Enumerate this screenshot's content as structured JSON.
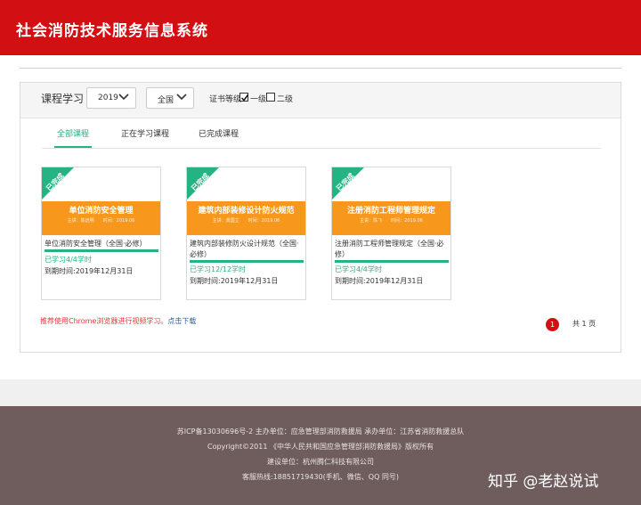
{
  "header": {
    "title": "社会消防技术服务信息系统"
  },
  "panel": {
    "title": "课程学习",
    "year_select": "2019",
    "scope_select": "全国",
    "cert_label": "证书等级",
    "cert_options": [
      {
        "label": "一级",
        "checked": true
      },
      {
        "label": "二级",
        "checked": false
      }
    ]
  },
  "tabs": [
    {
      "label": "全部课程",
      "active": true
    },
    {
      "label": "正在学习课程",
      "active": false
    },
    {
      "label": "已完成课程",
      "active": false
    }
  ],
  "courses": [
    {
      "ribbon": "已完成",
      "cover_title": "单位消防安全管理",
      "cover_sub": "主讲：陈远明　　时间：2019.06",
      "name": "单位消防安全管理（全国·必修）",
      "progress": 1.0,
      "learned": "已学习4/4学时",
      "deadline": "到期时间:2019年12月31日"
    },
    {
      "ribbon": "已完成",
      "cover_title": "建筑内部装修设计防火规范",
      "cover_sub": "主讲：龚国立　　时间：2019.06",
      "name": "建筑内部装修防火设计规范（全国·必修）",
      "progress": 1.0,
      "learned": "已学习12/12学时",
      "deadline": "到期时间:2019年12月31日"
    },
    {
      "ribbon": "已完成",
      "cover_title": "注册消防工程师管理规定",
      "cover_sub": "主讲：陈飞　　时间：2019.06",
      "name": "注册消防工程师管理规定（全国·必修）",
      "progress": 1.0,
      "learned": "已学习4/4学时",
      "deadline": "到期时间:2019年12月31日"
    }
  ],
  "notice": {
    "text": "推荐使用Chrome浏览器进行视频学习。",
    "link": "点击下载"
  },
  "pager": {
    "current": "1",
    "total_text": "共 1 页"
  },
  "footer": {
    "line1": "苏ICP备13030696号-2 主办单位：应急管理部消防救援局 承办单位：江苏省消防救援总队",
    "line2": "Copyright©2011 《中华人民共和国应急管理部消防救援局》版权所有",
    "line3": "建设单位：杭州腾仁科技有限公司",
    "line4": "客服热线:18851719430(手机、微信、QQ 同号)"
  },
  "watermark": "知乎 @老赵说试",
  "colors": {
    "brand_red": "#d20f12",
    "accent_green": "#24b383",
    "cover_orange": "#f7981d",
    "footer_bg": "#6f5d5d"
  }
}
